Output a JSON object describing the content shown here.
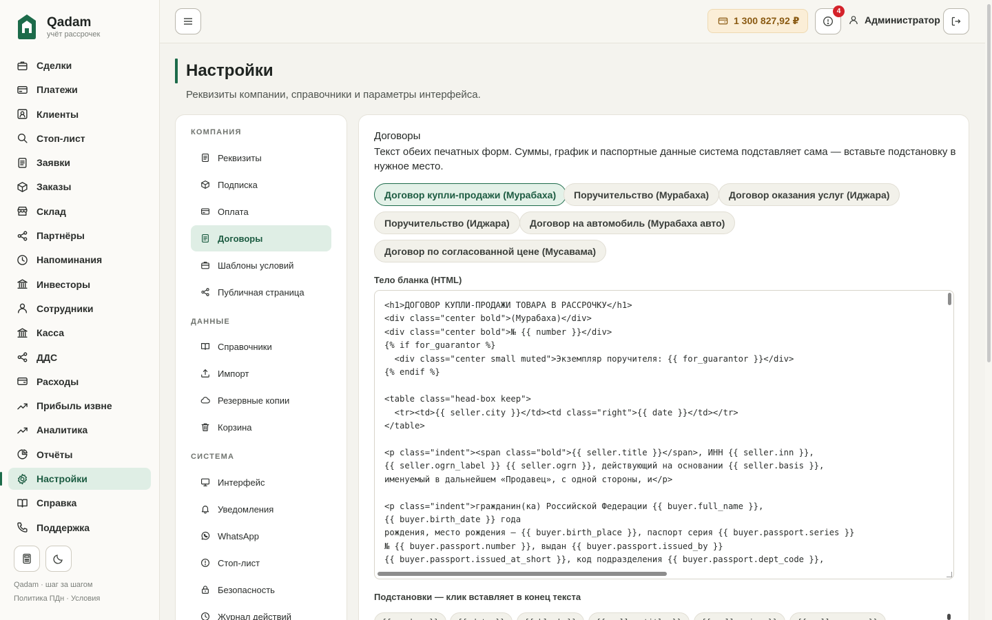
{
  "brand": {
    "name": "Qadam",
    "tagline": "учёт рассрочек"
  },
  "sidebar": {
    "items": [
      {
        "label": "Сделки",
        "icon": "briefcase-icon"
      },
      {
        "label": "Платежи",
        "icon": "card-icon"
      },
      {
        "label": "Клиенты",
        "icon": "user-card-icon"
      },
      {
        "label": "Стоп-лист",
        "icon": "search-icon"
      },
      {
        "label": "Заявки",
        "icon": "document-icon"
      },
      {
        "label": "Заказы",
        "icon": "box-icon"
      },
      {
        "label": "Склад",
        "icon": "store-icon"
      },
      {
        "label": "Партнёры",
        "icon": "share-icon"
      },
      {
        "label": "Напоминания",
        "icon": "clock-icon"
      },
      {
        "label": "Инвесторы",
        "icon": "bank-icon"
      },
      {
        "label": "Сотрудники",
        "icon": "person-icon"
      },
      {
        "label": "Касса",
        "icon": "bank-icon"
      },
      {
        "label": "ДДС",
        "icon": "share-icon"
      },
      {
        "label": "Расходы",
        "icon": "wallet-icon"
      },
      {
        "label": "Прибыль извне",
        "icon": "trend-icon"
      },
      {
        "label": "Аналитика",
        "icon": "trend-icon"
      },
      {
        "label": "Отчёты",
        "icon": "pie-icon"
      },
      {
        "label": "Настройки",
        "icon": "gear-icon",
        "active": true
      },
      {
        "label": "Справка",
        "icon": "book-icon"
      },
      {
        "label": "Поддержка",
        "icon": "phone-icon"
      }
    ],
    "footer": {
      "line1": "Qadam · шаг за шагом",
      "privacy": "Политика ПДн",
      "separator": " · ",
      "terms": "Условия"
    }
  },
  "topbar": {
    "balance": "1 300 827,92 ₽",
    "alerts_count": "4",
    "user_name": "Администратор"
  },
  "page": {
    "title": "Настройки",
    "description": "Реквизиты компании, справочники и параметры интерфейса."
  },
  "settings_nav": {
    "sections": [
      {
        "title": "КОМПАНИЯ",
        "items": [
          {
            "label": "Реквизиты",
            "icon": "document-icon"
          },
          {
            "label": "Подписка",
            "icon": "box-icon"
          },
          {
            "label": "Оплата",
            "icon": "card-icon"
          },
          {
            "label": "Договоры",
            "icon": "document-icon",
            "active": true
          },
          {
            "label": "Шаблоны условий",
            "icon": "briefcase-icon"
          },
          {
            "label": "Публичная страница",
            "icon": "share-icon"
          }
        ]
      },
      {
        "title": "ДАННЫЕ",
        "items": [
          {
            "label": "Справочники",
            "icon": "book-icon"
          },
          {
            "label": "Импорт",
            "icon": "upload-icon"
          },
          {
            "label": "Резервные копии",
            "icon": "cloud-icon"
          },
          {
            "label": "Корзина",
            "icon": "trash-icon"
          }
        ]
      },
      {
        "title": "СИСТЕМА",
        "items": [
          {
            "label": "Интерфейс",
            "icon": "monitor-icon"
          },
          {
            "label": "Уведомления",
            "icon": "bell-icon"
          },
          {
            "label": "WhatsApp",
            "icon": "whatsapp-icon"
          },
          {
            "label": "Стоп-лист",
            "icon": "alert-icon"
          },
          {
            "label": "Безопасность",
            "icon": "lock-icon"
          },
          {
            "label": "Журнал действий",
            "icon": "clock-icon"
          }
        ]
      }
    ]
  },
  "contracts": {
    "title": "Договоры",
    "description": "Текст обеих печатных форм. Суммы, график и паспортные данные система подставляет сама — вставьте подстановку в нужное место.",
    "templates": [
      {
        "label": "Договор купли-продажи (Мурабаха)",
        "active": true
      },
      {
        "label": "Поручительство (Мурабаха)"
      },
      {
        "label": "Договор оказания услуг (Иджара)"
      },
      {
        "label": "Поручительство (Иджара)"
      },
      {
        "label": "Договор на автомобиль (Мурабаха авто)"
      },
      {
        "label": "Договор по согласованной цене (Мусавама)"
      }
    ],
    "body_label": "Тело бланка (HTML)",
    "body_lines": [
      "<h1>ДОГОВОР КУПЛИ-ПРОДАЖИ ТОВАРА В РАССРОЧКУ</h1>",
      "<div class=\"center bold\">(Мурабаха)</div>",
      "<div class=\"center bold\">№ {{ number }}</div>",
      "{% if for_guarantor %}",
      "  <div class=\"center small muted\">Экземпляр поручителя: {{ for_guarantor }}</div>",
      "{% endif %}",
      "",
      "<table class=\"head-box keep\">",
      "  <tr><td>{{ seller.city }}</td><td class=\"right\">{{ date }}</td></tr>",
      "</table>",
      "",
      "<p class=\"indent\"><span class=\"bold\">{{ seller.title }}</span>, ИНН {{ seller.inn }},",
      "{{ seller.ogrn_label }} {{ seller.ogrn }}, действующий на основании {{ seller.basis }},",
      "именуемый в дальнейшем «Продавец», с одной стороны, и</p>",
      "",
      "<p class=\"indent\">гражданин(ка) Российской Федерации {{ buyer.full_name }},",
      "{{ buyer.birth_date }} года",
      "рождения, место рождения — {{ buyer.birth_place }}, паспорт серия {{ buyer.passport.series }}",
      "№ {{ buyer.passport.number }}, выдан {{ buyer.passport.issued_by }}",
      "{{ buyer.passport.issued_at_short }}, код подразделения {{ buyer.passport.dept_code }},"
    ],
    "subs_label": "Подстановки — клик вставляет в конец текста",
    "substitutions": [
      "{{ number }}",
      "{{ date }}",
      "{{ blank }}",
      "{{ seller.title }}",
      "{{ seller.inn }}",
      "{{ seller.ogrn }}"
    ]
  },
  "colors": {
    "accent": "#1c6b4a",
    "active_bg": "#dfeee5",
    "badge": "#d4222a",
    "balance_bg": "#fbeed7"
  }
}
